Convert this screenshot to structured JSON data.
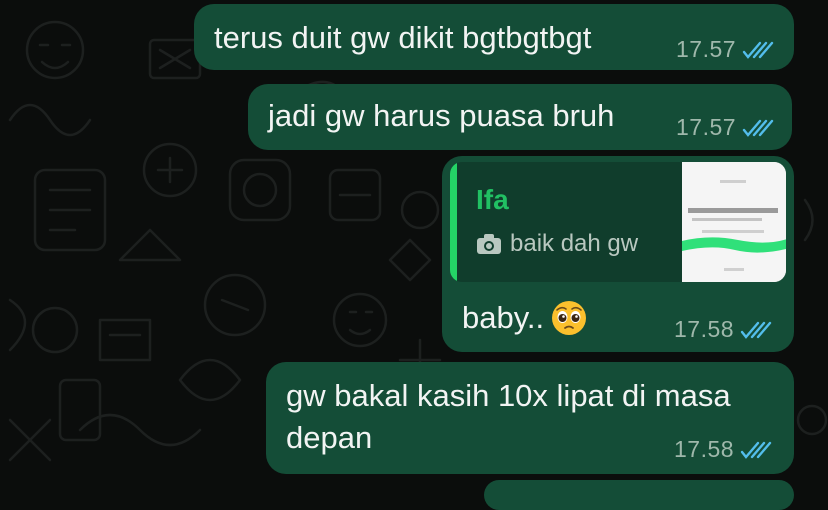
{
  "chat": {
    "messages": [
      {
        "text": "terus duit gw dikit bgtbgtbgt",
        "time": "17.57"
      },
      {
        "text": "jadi gw harus puasa bruh",
        "time": "17.57"
      },
      {
        "reply": {
          "author": "Ifa",
          "text": "baik dah gw",
          "icon": "camera-icon"
        },
        "text": "baby..",
        "emoji": "pleading-face",
        "time": "17.58"
      },
      {
        "text_line1": "gw bakal kasih 10x lipat di masa",
        "text_line2": "depan",
        "time": "17.58"
      }
    ]
  },
  "colors": {
    "background": "#0b0d0c",
    "bubble": "#144d37",
    "quote_bg": "#103d2c",
    "accent": "#24d366",
    "read_ticks": "#53bdeb"
  }
}
